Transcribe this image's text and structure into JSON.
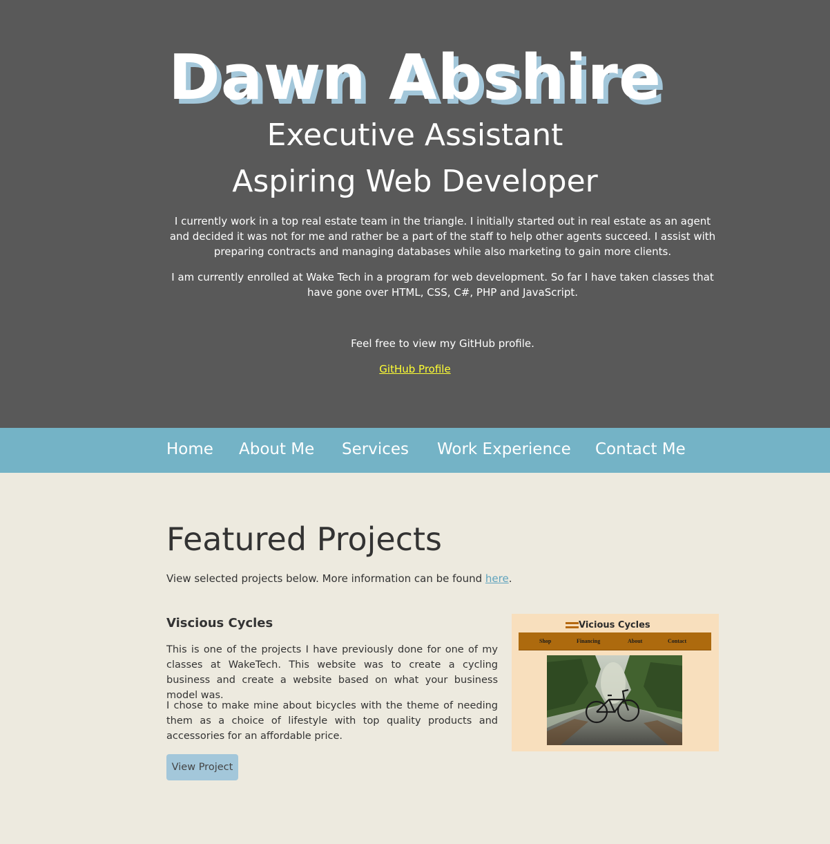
{
  "hero": {
    "name": "Dawn Abshire",
    "role_1": "Executive Assistant",
    "role_2": "Aspiring Web Developer",
    "paragraph_1": "I currently work in a top real estate team in the triangle. I initially started out in real estate as an agent and decided it was not for me and rather be a part of the staff to help other agents succeed. I assist with preparing contracts and managing databases while also marketing to gain more clients.",
    "paragraph_2": "I am currently enrolled at Wake Tech in a program for web development. So far I have taken classes that have gone over HTML, CSS, C#, PHP and JavaScript.",
    "paragraph_3": "Feel free to view my GitHub profile.",
    "github_link": "GitHub Profile"
  },
  "nav": {
    "items": [
      {
        "label": "Home"
      },
      {
        "label": "About Me"
      },
      {
        "label": "Services"
      },
      {
        "label": "Work Experience"
      },
      {
        "label": "Contact Me"
      }
    ]
  },
  "featured": {
    "title": "Featured Projects",
    "intro_text": "View selected projects below. More information can be found ",
    "intro_link": "here",
    "intro_end": "."
  },
  "project": {
    "title": "Viscious Cycles",
    "paragraph_1": "This is one of the projects I have previously done for one of my classes at WakeTech. This website was to create a cycling business and create a website based on what your business model was.",
    "paragraph_2": "I chose to make mine about bicycles with the theme of needing them as a choice of lifestyle with top quality products and accessories for an affordable price.",
    "button_label": "View Project",
    "thumbnail": {
      "logo_text": "Vicious Cycles",
      "nav": [
        "Shop",
        "Financing",
        "About",
        "Contact"
      ]
    }
  },
  "colors": {
    "hero_bg": "#595959",
    "nav_bg": "#74b3c6",
    "page_bg": "#edeadf",
    "name_shadow": "#a3c7da",
    "link_yellow": "#ffff33",
    "button_bg": "#a3c7da"
  }
}
